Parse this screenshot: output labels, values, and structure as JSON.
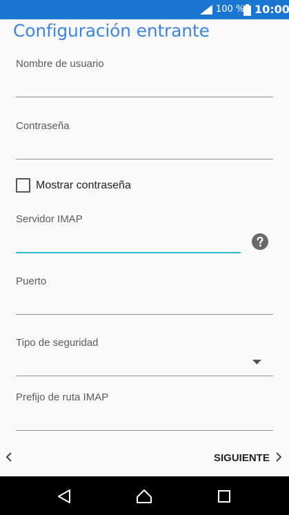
{
  "status_bar": {
    "battery_percent": "100 %",
    "time": "10:00",
    "icons": [
      "signal-icon",
      "battery-icon"
    ]
  },
  "page": {
    "title": "Configuración entrante"
  },
  "fields": {
    "username": {
      "label": "Nombre de usuario",
      "value": ""
    },
    "password": {
      "label": "Contraseña",
      "value": ""
    },
    "show_password": {
      "label": "Mostrar contraseña",
      "checked": false
    },
    "imap_server": {
      "label": "Servidor IMAP",
      "value": "",
      "focused": true
    },
    "port": {
      "label": "Puerto",
      "value": ""
    },
    "security_type": {
      "label": "Tipo de seguridad",
      "value": ""
    },
    "imap_prefix": {
      "label": "Prefijo de ruta IMAP",
      "value": ""
    }
  },
  "footer": {
    "next_label": "SIGUIENTE"
  },
  "nav_bar": {
    "buttons": [
      "back-icon",
      "home-icon",
      "recents-icon"
    ]
  },
  "colors": {
    "status_bar": "#1976d2",
    "title": "#3d86e0",
    "focus_underline": "#26bccd",
    "background": "#f9f9f9"
  }
}
